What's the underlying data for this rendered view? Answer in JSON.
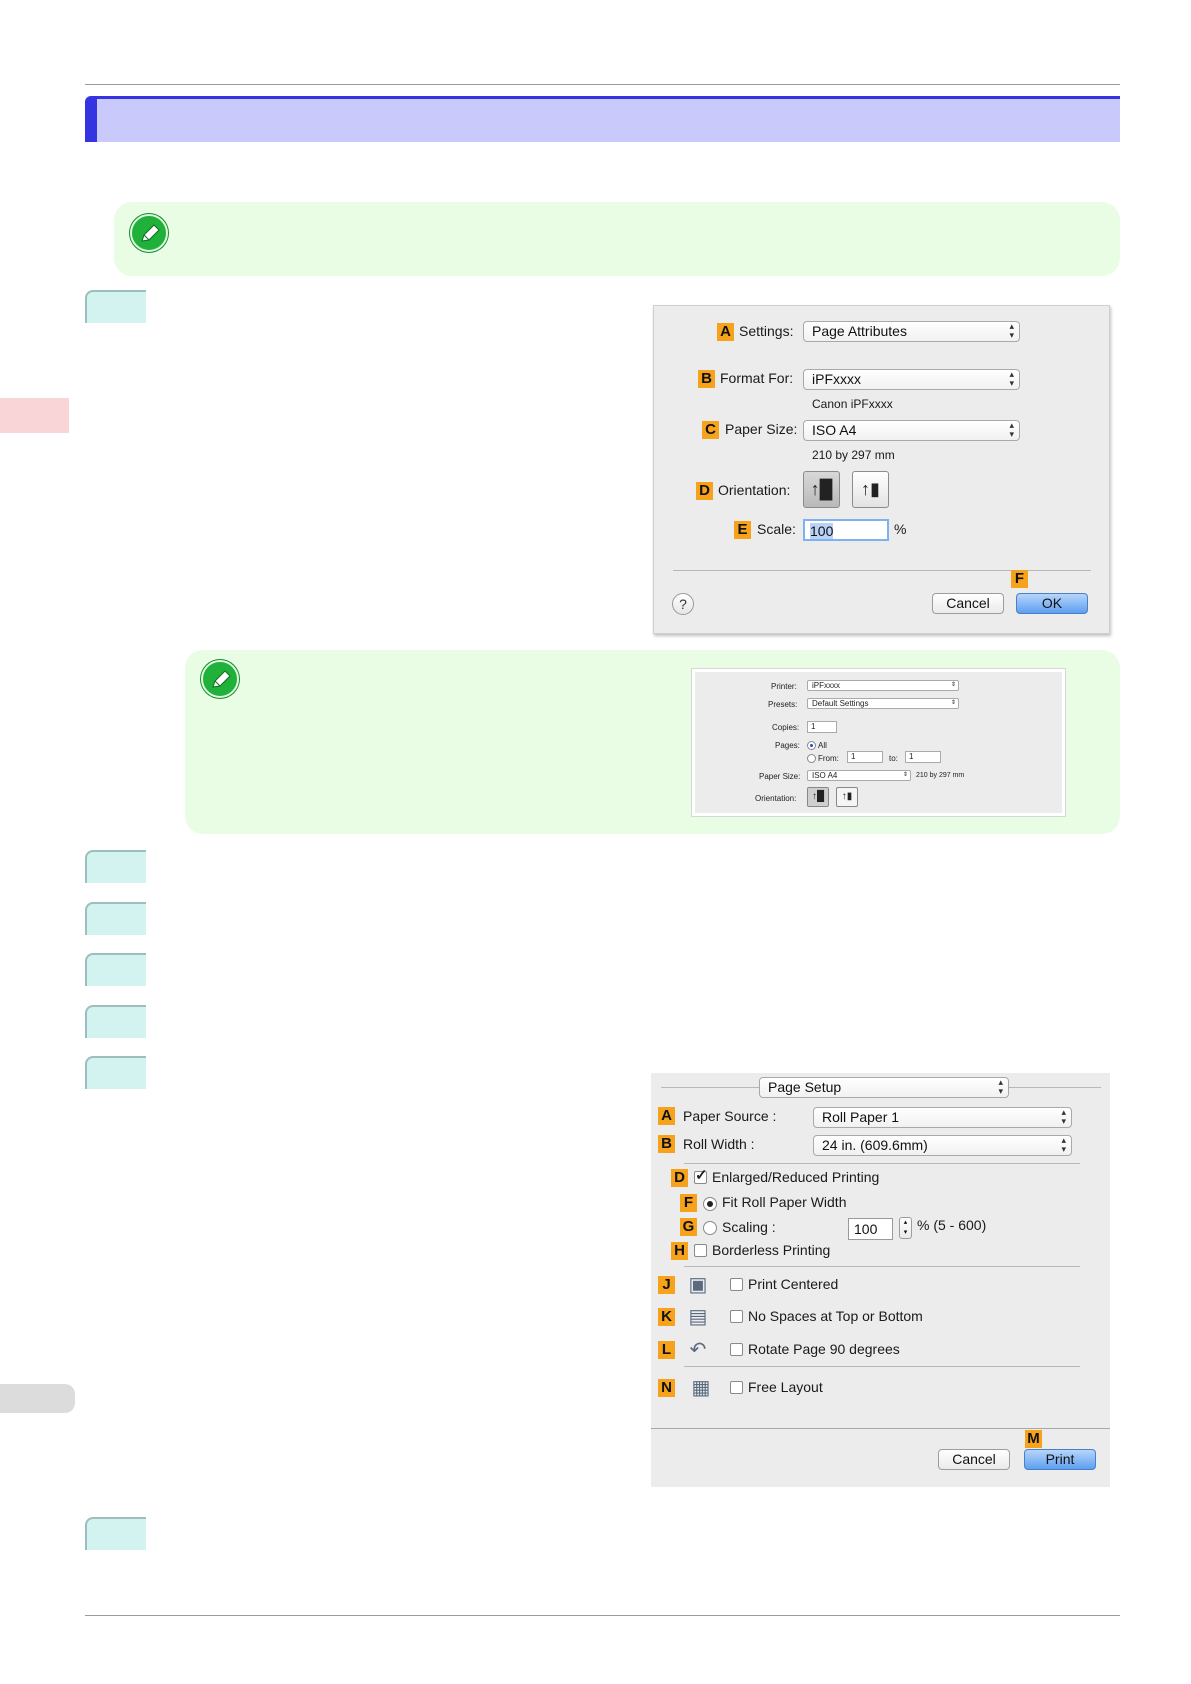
{
  "page_setup_dialog": {
    "settings": {
      "key": "A",
      "label": "Settings:",
      "value": "Page Attributes"
    },
    "format_for": {
      "key": "B",
      "label": "Format For:",
      "value": "iPFxxxx",
      "sub": "Canon iPFxxxx"
    },
    "paper_size": {
      "key": "C",
      "label": "Paper Size:",
      "value": "ISO A4",
      "sub": "210 by 297 mm"
    },
    "orientation": {
      "key": "D",
      "label": "Orientation:"
    },
    "scale": {
      "key": "E",
      "label": "Scale:",
      "value": "100",
      "unit": "%"
    },
    "help_label": "?",
    "ok_key": "F",
    "cancel_label": "Cancel",
    "ok_label": "OK"
  },
  "print_dialog_mini": {
    "printer": {
      "label": "Printer:",
      "value": "iPFxxxx"
    },
    "presets": {
      "label": "Presets:",
      "value": "Default Settings"
    },
    "copies": {
      "label": "Copies:",
      "value": "1"
    },
    "pages": {
      "label": "Pages:",
      "all": "All",
      "from": "From:",
      "from_value": "1",
      "to": "to:",
      "to_value": "1"
    },
    "paper_size": {
      "label": "Paper Size:",
      "value": "ISO A4",
      "sub": "210 by 297 mm"
    },
    "orientation": {
      "label": "Orientation:"
    }
  },
  "print_dialog": {
    "panel": "Page Setup",
    "paper_source": {
      "key": "A",
      "label": "Paper Source :",
      "value": "Roll Paper 1"
    },
    "roll_width": {
      "key": "B",
      "label": "Roll Width :",
      "value": "24 in. (609.6mm)"
    },
    "enlarged": {
      "key": "D",
      "label": "Enlarged/Reduced Printing",
      "checked": true
    },
    "fit_roll": {
      "key": "F",
      "label": "Fit Roll Paper Width",
      "selected": true
    },
    "scaling": {
      "key": "G",
      "label": "Scaling :",
      "value": "100",
      "range": "% (5 - 600)"
    },
    "borderless": {
      "key": "H",
      "label": "Borderless Printing"
    },
    "print_centered": {
      "key": "J",
      "label": "Print Centered"
    },
    "no_spaces": {
      "key": "K",
      "label": "No Spaces at Top or Bottom"
    },
    "rotate": {
      "key": "L",
      "label": "Rotate Page 90 degrees"
    },
    "free_layout": {
      "key": "N",
      "label": "Free Layout"
    },
    "print_key": "M",
    "cancel_label": "Cancel",
    "print_label": "Print"
  },
  "icons": [
    "pencil-icon",
    "portrait-icon",
    "landscape-icon",
    "print-centered-icon",
    "no-spaces-icon",
    "rotate-page-icon",
    "free-layout-icon"
  ],
  "colors": {
    "title_bar": "#c9c9fb",
    "title_accent": "#3434e0",
    "note_bg": "#e9fde4",
    "step_tab": "#d3f3f0",
    "key_badge": "#f6a21b",
    "ok_button": "#5e9ff0"
  }
}
